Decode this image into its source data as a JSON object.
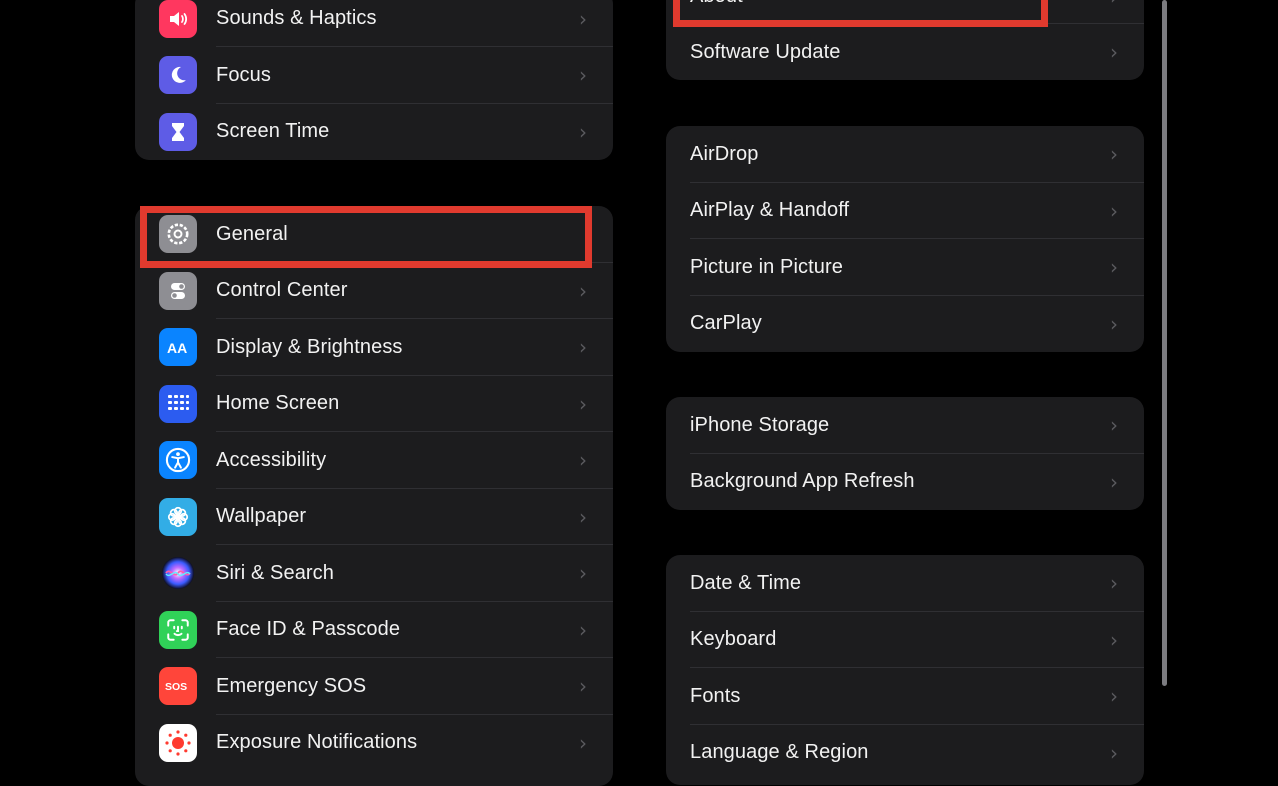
{
  "left_group_top": {
    "items": [
      {
        "label": "Sounds & Haptics",
        "icon": "speaker-icon",
        "color": "#ff375f"
      },
      {
        "label": "Focus",
        "icon": "moon-icon",
        "color": "#5e5ce6"
      },
      {
        "label": "Screen Time",
        "icon": "hourglass-icon",
        "color": "#5e5ce6"
      }
    ]
  },
  "left_group_main": {
    "items": [
      {
        "label": "General",
        "icon": "gear-icon",
        "color": "#8e8e93"
      },
      {
        "label": "Control Center",
        "icon": "toggles-icon",
        "color": "#8e8e93"
      },
      {
        "label": "Display & Brightness",
        "icon": "text-size-icon",
        "color": "#0a84ff"
      },
      {
        "label": "Home Screen",
        "icon": "app-grid-icon",
        "color": "#2c5cf0"
      },
      {
        "label": "Accessibility",
        "icon": "accessibility-icon",
        "color": "#0a84ff"
      },
      {
        "label": "Wallpaper",
        "icon": "flower-icon",
        "color": "#32ade6"
      },
      {
        "label": "Siri & Search",
        "icon": "siri-icon",
        "color": "#1c1c1e"
      },
      {
        "label": "Face ID & Passcode",
        "icon": "face-id-icon",
        "color": "#30d158"
      },
      {
        "label": "Emergency SOS",
        "icon": "sos-icon",
        "color": "#ff453a"
      },
      {
        "label": "Exposure Notifications",
        "icon": "exposure-icon",
        "color": "#ffffff"
      }
    ]
  },
  "right_group_1": {
    "items": [
      {
        "label": "About"
      },
      {
        "label": "Software Update"
      }
    ]
  },
  "right_group_2": {
    "items": [
      {
        "label": "AirDrop"
      },
      {
        "label": "AirPlay & Handoff"
      },
      {
        "label": "Picture in Picture"
      },
      {
        "label": "CarPlay"
      }
    ]
  },
  "right_group_3": {
    "items": [
      {
        "label": "iPhone Storage"
      },
      {
        "label": "Background App Refresh"
      }
    ]
  },
  "right_group_4": {
    "items": [
      {
        "label": "Date & Time"
      },
      {
        "label": "Keyboard"
      },
      {
        "label": "Fonts"
      },
      {
        "label": "Language & Region"
      }
    ]
  },
  "chevron": "›",
  "highlight_color": "#e03a2e"
}
